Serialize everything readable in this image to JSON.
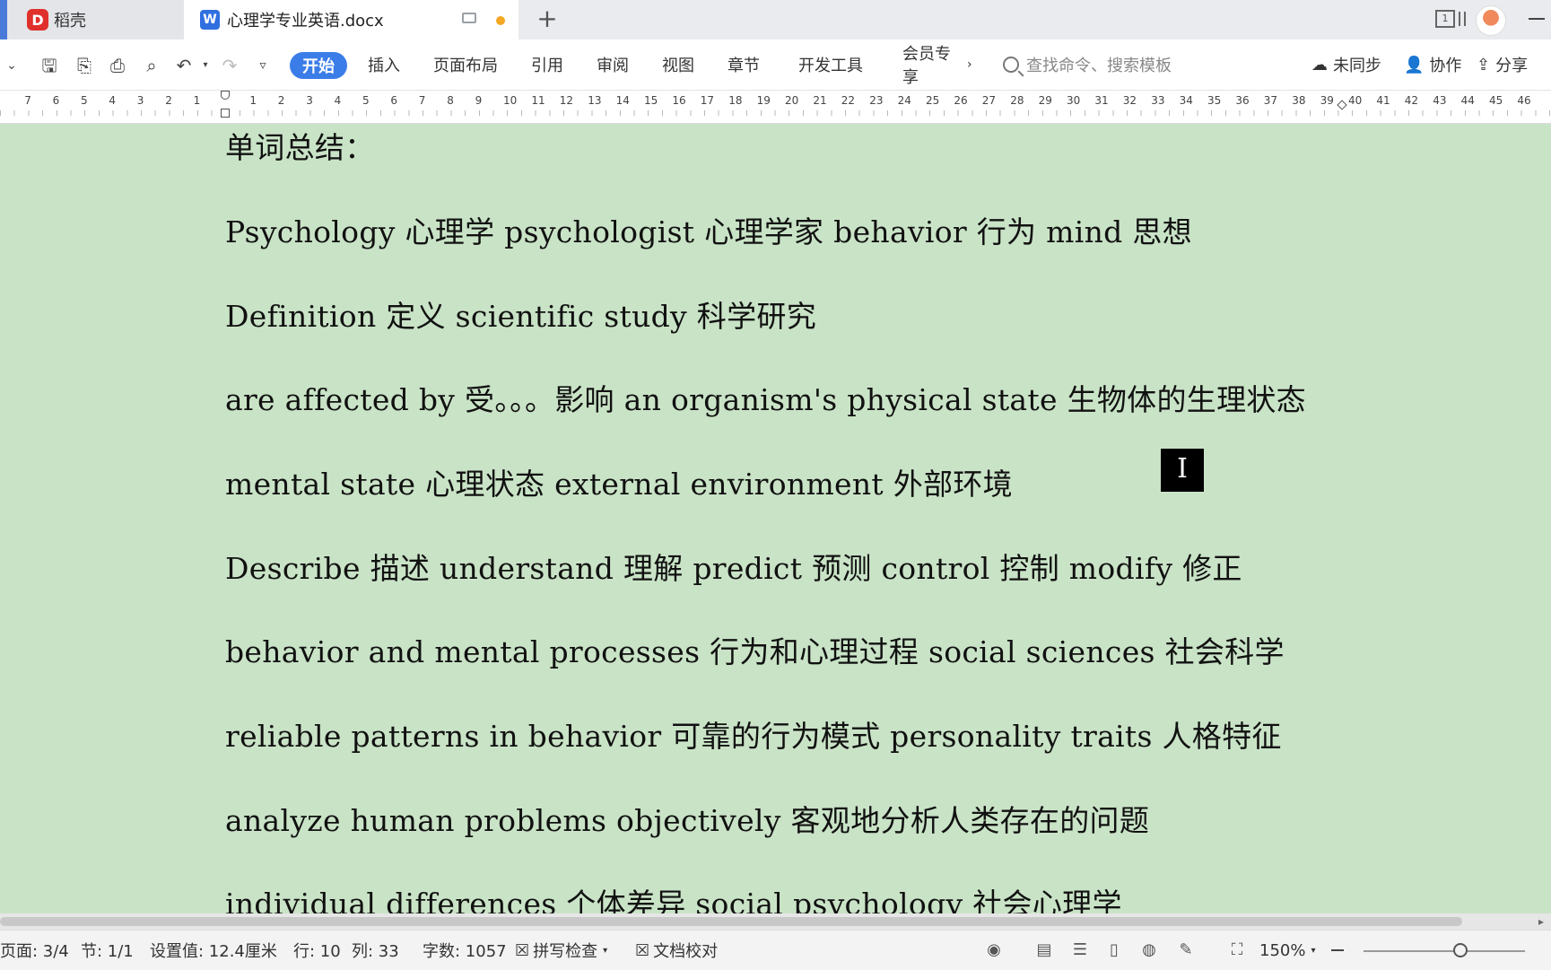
{
  "tabs": {
    "home_label": "稻壳",
    "home_logo": "D",
    "doc_label": "心理学专业英语.docx",
    "doc_logo": "W",
    "new_tab": "+"
  },
  "toolbar": {
    "menu": [
      "开始",
      "插入",
      "页面布局",
      "引用",
      "审阅",
      "视图",
      "章节",
      "开发工具",
      "会员专享"
    ],
    "search_placeholder": "查找命令、搜索模板",
    "sync": "未同步",
    "collab": "协作",
    "share": "分享"
  },
  "ruler": {
    "left_numbers": [
      "7",
      "6",
      "5",
      "4",
      "3",
      "2",
      "1"
    ],
    "right_numbers": [
      "1",
      "2",
      "3",
      "4",
      "5",
      "6",
      "7",
      "8",
      "9",
      "10",
      "11",
      "12",
      "13",
      "14",
      "15",
      "16",
      "17",
      "18",
      "19",
      "20",
      "21",
      "22",
      "23",
      "24",
      "25",
      "26",
      "27",
      "28",
      "29",
      "30",
      "31",
      "32",
      "33",
      "34",
      "35",
      "36",
      "37",
      "38",
      "39",
      "40",
      "41",
      "42",
      "43",
      "44",
      "45",
      "46"
    ]
  },
  "document": {
    "lines": [
      "单词总结：",
      "Psychology 心理学   psychologist 心理学家  behavior 行为   mind 思想",
      "Definition 定义  scientific study 科学研究",
      "  are affected by 受。。。影响  an organism's physical state 生物体的生理状态",
      "mental state 心理状态 external environment 外部环境",
      "Describe 描述 understand 理解 predict 预测 control 控制  modify 修正",
      "behavior and mental processes 行为和心理过程 social sciences 社会科学",
      "  reliable patterns in behavior 可靠的行为模式 personality traits 人格特征",
      "  analyze human problems objectively 客观地分析人类存在的问题",
      "  individual differences 个体差异 social psychology 社会心理学"
    ],
    "cursor_glyph": "I"
  },
  "status": {
    "page": "页面: 3/4",
    "section": "节: 1/1",
    "setting": "设置值: 12.4厘米",
    "row": "行: 10",
    "col": "列: 33",
    "words": "字数: 1057",
    "spellcheck": "拼写检查",
    "proofread": "文档校对",
    "zoom": "150%"
  },
  "colors": {
    "page_background": "#c9e3c6",
    "accent": "#3b7de8",
    "unsaved_dot": "#f5a623"
  }
}
